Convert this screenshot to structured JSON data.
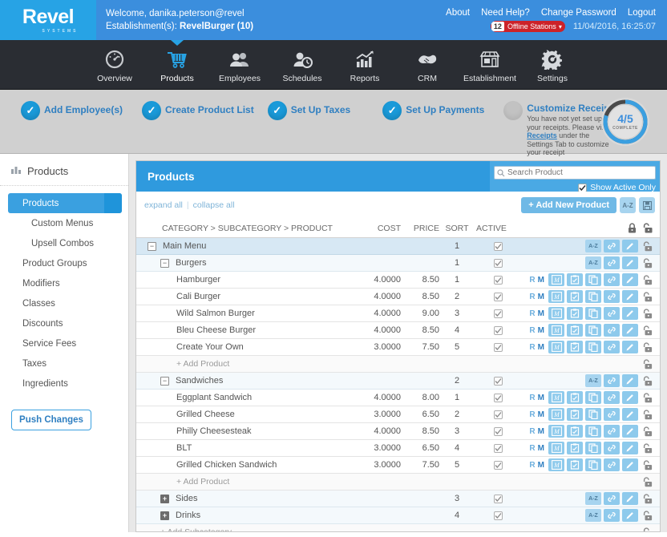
{
  "topbar": {
    "logo": "Revel",
    "logo_sub": "SYSTEMS",
    "welcome": "Welcome, danika.peterson@revel",
    "establishment_label": "Establishment(s): ",
    "establishment_value": "RevelBurger (10)",
    "links": [
      "About",
      "Need Help?",
      "Change Password",
      "Logout"
    ],
    "offline_count": "12",
    "offline_label": "Offline Stations",
    "timestamp": "11/04/2016, 16:25:07",
    "bg_color": "#3b8edd",
    "logo_bg_color": "#27a3e5"
  },
  "nav": {
    "items": [
      {
        "label": "Overview",
        "icon": "gauge-icon",
        "active": false
      },
      {
        "label": "Products",
        "icon": "cart-icon",
        "active": true
      },
      {
        "label": "Employees",
        "icon": "people-icon",
        "active": false
      },
      {
        "label": "Schedules",
        "icon": "person-clock-icon",
        "active": false
      },
      {
        "label": "Reports",
        "icon": "bar-chart-icon",
        "active": false
      },
      {
        "label": "CRM",
        "icon": "handshake-icon",
        "active": false
      },
      {
        "label": "Establishment",
        "icon": "storefront-icon",
        "active": false
      },
      {
        "label": "Settings",
        "icon": "gear-icon",
        "active": false
      }
    ],
    "bg_color": "#2a2d33",
    "active_color": "#27a3e5"
  },
  "wizard": {
    "steps": [
      {
        "label": "Add Employee(s)",
        "complete": true
      },
      {
        "label": "Create Product List",
        "complete": true
      },
      {
        "label": "Set Up Taxes",
        "complete": true
      },
      {
        "label": "Set Up Payments",
        "complete": true
      },
      {
        "label": "Customize Receipts",
        "complete": false
      }
    ],
    "receipts_desc_1": "You have not yet set up your receipts. Please visit ",
    "receipts_link": "Receipts",
    "receipts_desc_2": " under the Settings Tab to customize your receipt",
    "progress_fraction": "4/5",
    "progress_label": "COMPLETE",
    "progress_percent": 80
  },
  "sidebar": {
    "header": "Products",
    "header_icon": "bar-chart-icon",
    "items": [
      {
        "label": "Products",
        "active": true,
        "sub": false
      },
      {
        "label": "Custom Menus",
        "active": false,
        "sub": true
      },
      {
        "label": "Upsell Combos",
        "active": false,
        "sub": true
      },
      {
        "label": "Product Groups",
        "active": false,
        "sub": false
      },
      {
        "label": "Modifiers",
        "active": false,
        "sub": false
      },
      {
        "label": "Classes",
        "active": false,
        "sub": false
      },
      {
        "label": "Discounts",
        "active": false,
        "sub": false
      },
      {
        "label": "Service Fees",
        "active": false,
        "sub": false
      },
      {
        "label": "Taxes",
        "active": false,
        "sub": false
      },
      {
        "label": "Ingredients",
        "active": false,
        "sub": false
      }
    ],
    "push_button": "Push Changes"
  },
  "panel": {
    "title": "Products",
    "search_placeholder": "Search Product",
    "search_value": "",
    "active_only_label": "Show Active Only",
    "active_only_checked": true,
    "expand_all": "expand all",
    "collapse_all": "collapse all",
    "add_new_product": "+ Add New Product",
    "sort_button": "A-Z",
    "save_button_icon": "save-disk-icon"
  },
  "table": {
    "columns": {
      "name": "CATEGORY > SUBCATEGORY > PRODUCT",
      "cost": "COST",
      "price": "PRICE",
      "sort": "SORT",
      "active": "ACTIVE"
    },
    "rows": [
      {
        "type": "category",
        "level": 0,
        "expanded": true,
        "name": "Main Menu",
        "cost": "",
        "price": "",
        "sort": "1",
        "active": true
      },
      {
        "type": "subcategory",
        "level": 1,
        "expanded": true,
        "name": "Burgers",
        "cost": "",
        "price": "",
        "sort": "1",
        "active": true
      },
      {
        "type": "product",
        "level": 2,
        "name": "Hamburger",
        "cost": "4.0000",
        "price": "8.50",
        "sort": "1",
        "active": true
      },
      {
        "type": "product",
        "level": 2,
        "name": "Cali Burger",
        "cost": "4.0000",
        "price": "8.50",
        "sort": "2",
        "active": true
      },
      {
        "type": "product",
        "level": 2,
        "name": "Wild Salmon Burger",
        "cost": "4.0000",
        "price": "9.00",
        "sort": "3",
        "active": true
      },
      {
        "type": "product",
        "level": 2,
        "name": "Bleu Cheese Burger",
        "cost": "4.0000",
        "price": "8.50",
        "sort": "4",
        "active": true
      },
      {
        "type": "product",
        "level": 2,
        "name": "Create Your Own",
        "cost": "3.0000",
        "price": "7.50",
        "sort": "5",
        "active": true
      },
      {
        "type": "add",
        "level": 2,
        "name": "+ Add Product"
      },
      {
        "type": "subcategory",
        "level": 1,
        "expanded": true,
        "name": "Sandwiches",
        "cost": "",
        "price": "",
        "sort": "2",
        "active": true
      },
      {
        "type": "product",
        "level": 2,
        "name": "Eggplant Sandwich",
        "cost": "4.0000",
        "price": "8.00",
        "sort": "1",
        "active": true
      },
      {
        "type": "product",
        "level": 2,
        "name": "Grilled Cheese",
        "cost": "3.0000",
        "price": "6.50",
        "sort": "2",
        "active": true
      },
      {
        "type": "product",
        "level": 2,
        "name": "Philly Cheesesteak",
        "cost": "4.0000",
        "price": "8.50",
        "sort": "3",
        "active": true
      },
      {
        "type": "product",
        "level": 2,
        "name": "BLT",
        "cost": "3.0000",
        "price": "6.50",
        "sort": "4",
        "active": true
      },
      {
        "type": "product",
        "level": 2,
        "name": "Grilled Chicken Sandwich",
        "cost": "3.0000",
        "price": "7.50",
        "sort": "5",
        "active": true
      },
      {
        "type": "add",
        "level": 2,
        "name": "+ Add Product"
      },
      {
        "type": "subcategory",
        "level": 1,
        "expanded": false,
        "name": "Sides",
        "cost": "",
        "price": "",
        "sort": "3",
        "active": true
      },
      {
        "type": "subcategory",
        "level": 1,
        "expanded": false,
        "name": "Drinks",
        "cost": "",
        "price": "",
        "sort": "4",
        "active": true
      },
      {
        "type": "add",
        "level": 1,
        "name": "+ Add Subcategory"
      }
    ],
    "row_action_labels": {
      "recipe": "R",
      "modifier": "M"
    },
    "product_icons": [
      "modifier-matrix-icon",
      "clipboard-check-icon",
      "duplicate-icon",
      "link-icon",
      "pencil-icon",
      "unlock-icon"
    ],
    "category_icons": [
      "sort-az-icon",
      "link-icon",
      "pencil-icon",
      "unlock-icon"
    ],
    "header_icons": [
      "lock-icon",
      "unlock-icon"
    ]
  }
}
